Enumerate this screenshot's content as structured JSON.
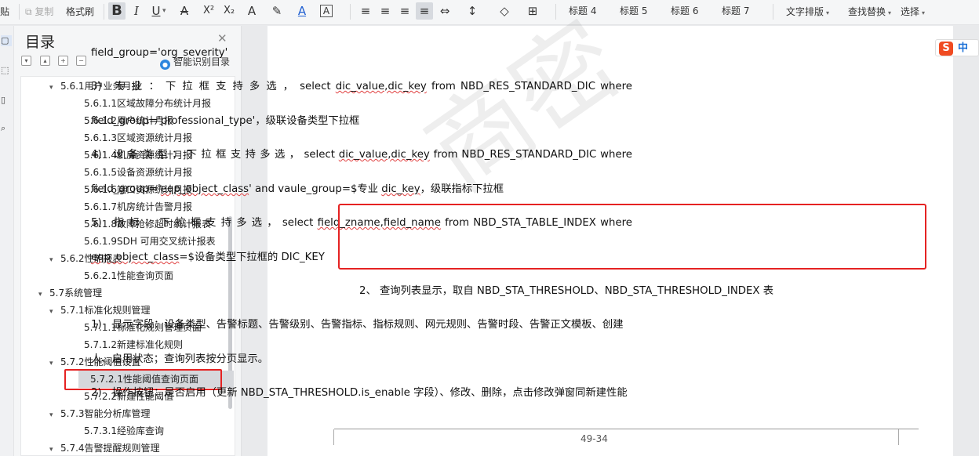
{
  "toolbar": {
    "paste": "贴",
    "copy": "复制",
    "format_painter": "格式刷",
    "bold": "B",
    "italic": "I",
    "underline": "U",
    "strikethrough": "A",
    "superscript": "X²",
    "subscript": "X₂",
    "text_effect": "A",
    "highlight": "✎",
    "font_color": "A",
    "char_border": "A",
    "align_left": "≡",
    "align_center": "≡",
    "align_right": "≡",
    "justify": "≡",
    "distribute": "⇔",
    "line_spacing": "↕",
    "shading": "◇",
    "borders": "⊞",
    "styles": [
      "标题 4",
      "标题 5",
      "标题 6",
      "标题 7"
    ],
    "text_layout": "文字排版",
    "find_replace": "查找替换",
    "select": "选择"
  },
  "toc": {
    "title": "目录",
    "smart_toc": "智能识别目录",
    "items": [
      {
        "label": "5.6.1用户业务月报",
        "level": 2,
        "expanded": true
      },
      {
        "label": "5.6.1.1区域故障分布统计月报",
        "level": 3
      },
      {
        "label": "5.6.1.2用户统计月报",
        "level": 3
      },
      {
        "label": "5.6.1.3区域资源统计月报",
        "level": 3
      },
      {
        "label": "5.6.1.4机房资源统计月报",
        "level": 3
      },
      {
        "label": "5.6.1.5设备资源统计月报",
        "level": 3
      },
      {
        "label": "5.6.1.6端口资源统计月报",
        "level": 3
      },
      {
        "label": "5.6.1.7机房统计告警月报",
        "level": 3
      },
      {
        "label": "5.6.1.8故障抢修超时统计报表",
        "level": 3
      },
      {
        "label": "5.6.1.9SDH 可用交叉统计报表",
        "level": 3
      },
      {
        "label": "5.6.2性能报表",
        "level": 2,
        "expanded": true
      },
      {
        "label": "5.6.2.1性能查询页面",
        "level": 3
      },
      {
        "label": "5.7系统管理",
        "level": 1,
        "expanded": true
      },
      {
        "label": "5.7.1标准化规则管理",
        "level": 2,
        "expanded": true
      },
      {
        "label": "5.7.1.1标准化规则管理页面",
        "level": 3
      },
      {
        "label": "5.7.1.2新建标准化规则",
        "level": 3
      },
      {
        "label": "5.7.2性能阈值设置",
        "level": 2,
        "expanded": true
      },
      {
        "label": "5.7.2.1性能阈值查询页面",
        "level": 3,
        "selected": true
      },
      {
        "label": "5.7.2.2新建性能阈值",
        "level": 3
      },
      {
        "label": "5.7.3智能分析库管理",
        "level": 2,
        "expanded": true
      },
      {
        "label": "5.7.3.1经验库查询",
        "level": 3
      },
      {
        "label": "5.7.4告警提醒规则管理",
        "level": 2,
        "expanded": true
      }
    ]
  },
  "document": {
    "watermark": "商密",
    "page_number": "49-34",
    "lines": {
      "l1": "field_group='org_severity'",
      "l2a": "3)　专 业 ： 下 拉 框 支 持 多 选 ， select ",
      "l2b": "dic_value,dic_key",
      "l2c": " from NBD_RES_STANDARD_DIC where",
      "l3": "field_group='professional_type'，级联设备类型下拉框",
      "l4a": "4)　设 备 类 型 ： 下 拉 框 支 持 多 选 ， select ",
      "l4b": "dic_value,dic_key",
      "l4c": " from NBD_RES_STANDARD_DIC where",
      "l5a": "field_group='",
      "l5b": "eqp_object_class",
      "l5c": "' and vaule_group=$专业 ",
      "l5d": "dic_key",
      "l5e": "，级联指标下拉框",
      "l6a": "5)　指 标 ： 下 拉 框 支 持 多 选 ， select ",
      "l6b": "field_zname,field_name",
      "l6c": " from NBD_STA_TABLE_INDEX where",
      "l7a": "eqp_object_class",
      "l7b": "=$设备类型下拉框的 DIC_KEY",
      "l8": "2、 查询列表显示，取自 NBD_STA_THRESHOLD、NBD_STA_THRESHOLD_INDEX 表",
      "l9": "1)　显示字段：设备类型、告警标题、告警级别、告警指标、指标规则、网元规则、告警时段、告警正文模板、创建",
      "l10": "人、启用状态；查询列表按分页显示。",
      "l11": "2)　操作按钮：是否启用（更新 NBD_STA_THRESHOLD.is_enable 字段）、修改、删除，点击修改弹窗同新建性能"
    }
  },
  "ime": {
    "logo": "S",
    "lang": "中"
  }
}
